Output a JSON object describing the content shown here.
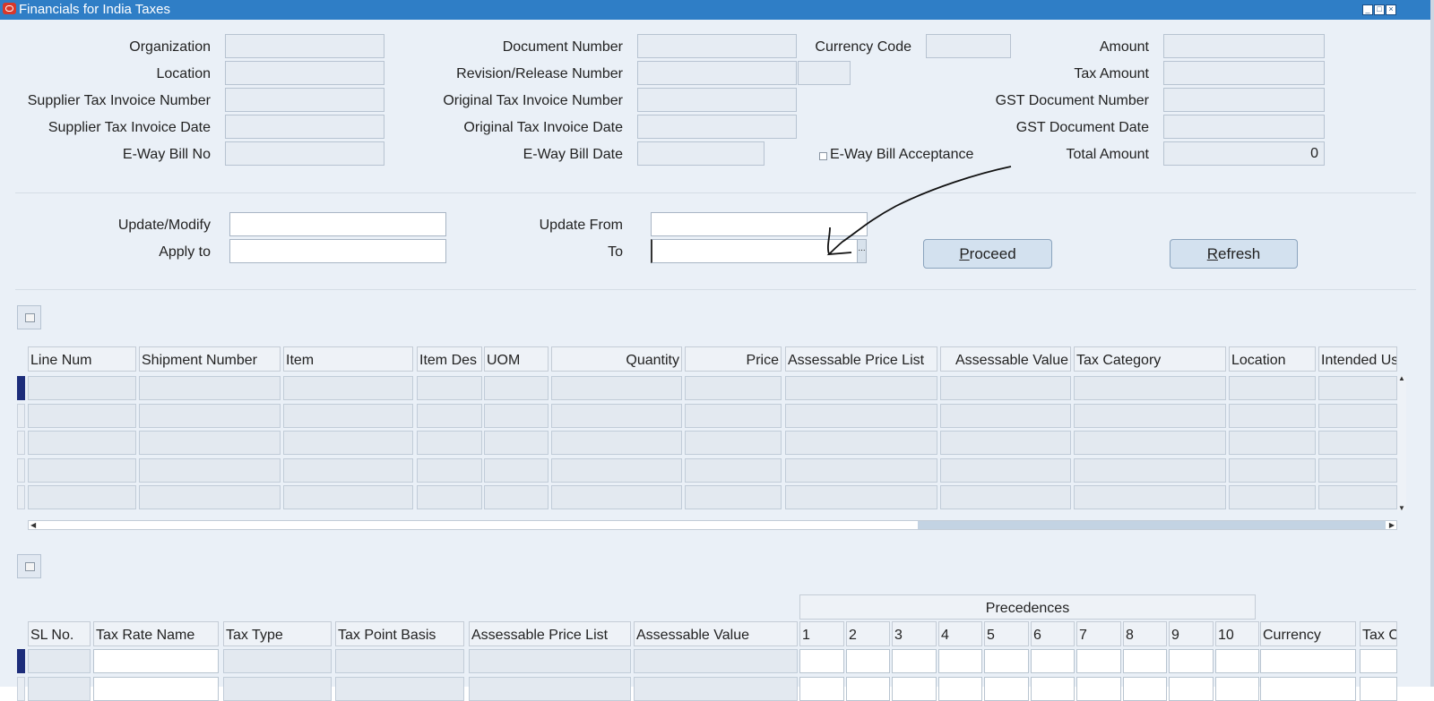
{
  "window": {
    "title": "Financials for India Taxes",
    "controls": [
      "minimize",
      "maximize",
      "close"
    ]
  },
  "header_fields": {
    "organization": {
      "label": "Organization",
      "value": ""
    },
    "location": {
      "label": "Location",
      "value": ""
    },
    "supplier_tax_invoice_number": {
      "label": "Supplier Tax Invoice Number",
      "value": ""
    },
    "supplier_tax_invoice_date": {
      "label": "Supplier Tax Invoice Date",
      "value": ""
    },
    "eway_bill_no": {
      "label": "E-Way Bill No",
      "value": ""
    },
    "document_number": {
      "label": "Document Number",
      "value": ""
    },
    "revision_release_number": {
      "label": "Revision/Release Number",
      "value": ""
    },
    "original_tax_invoice_number": {
      "label": "Original Tax Invoice Number",
      "value": ""
    },
    "original_tax_invoice_date": {
      "label": "Original Tax Invoice Date",
      "value": ""
    },
    "eway_bill_date": {
      "label": "E-Way Bill Date",
      "value": ""
    },
    "currency_code": {
      "label": "Currency Code",
      "value": ""
    },
    "eway_bill_acceptance": {
      "label": "E-Way Bill Acceptance",
      "checked": false
    },
    "amount": {
      "label": "Amount",
      "value": ""
    },
    "tax_amount": {
      "label": "Tax Amount",
      "value": ""
    },
    "gst_document_number": {
      "label": "GST Document Number",
      "value": ""
    },
    "gst_document_date": {
      "label": "GST Document Date",
      "value": ""
    },
    "total_amount": {
      "label": "Total Amount",
      "value": "0"
    }
  },
  "update_section": {
    "update_modify": {
      "label": "Update/Modify",
      "value": ""
    },
    "apply_to": {
      "label": "Apply to",
      "value": ""
    },
    "update_from": {
      "label": "Update From",
      "value": ""
    },
    "to": {
      "label": "To",
      "value": "",
      "lov_button": "..."
    },
    "proceed_button": {
      "accel": "P",
      "rest": "roceed"
    },
    "refresh_button": {
      "accel": "R",
      "rest": "efresh"
    }
  },
  "lines_table": {
    "columns": [
      "Line Num",
      "Shipment Number",
      "Item",
      "Item Des",
      "UOM",
      "Quantity",
      "Price",
      "Assessable Price List",
      "Assessable Value",
      "Tax Category",
      "Location",
      "Intended Us"
    ],
    "row_count": 5
  },
  "tax_table": {
    "group_header": "Precedences",
    "columns": [
      "SL No.",
      "Tax Rate Name",
      "Tax Type",
      "Tax Point Basis",
      "Assessable Price List",
      "Assessable Value",
      "1",
      "2",
      "3",
      "4",
      "5",
      "6",
      "7",
      "8",
      "9",
      "10",
      "Currency",
      "Tax C"
    ]
  }
}
